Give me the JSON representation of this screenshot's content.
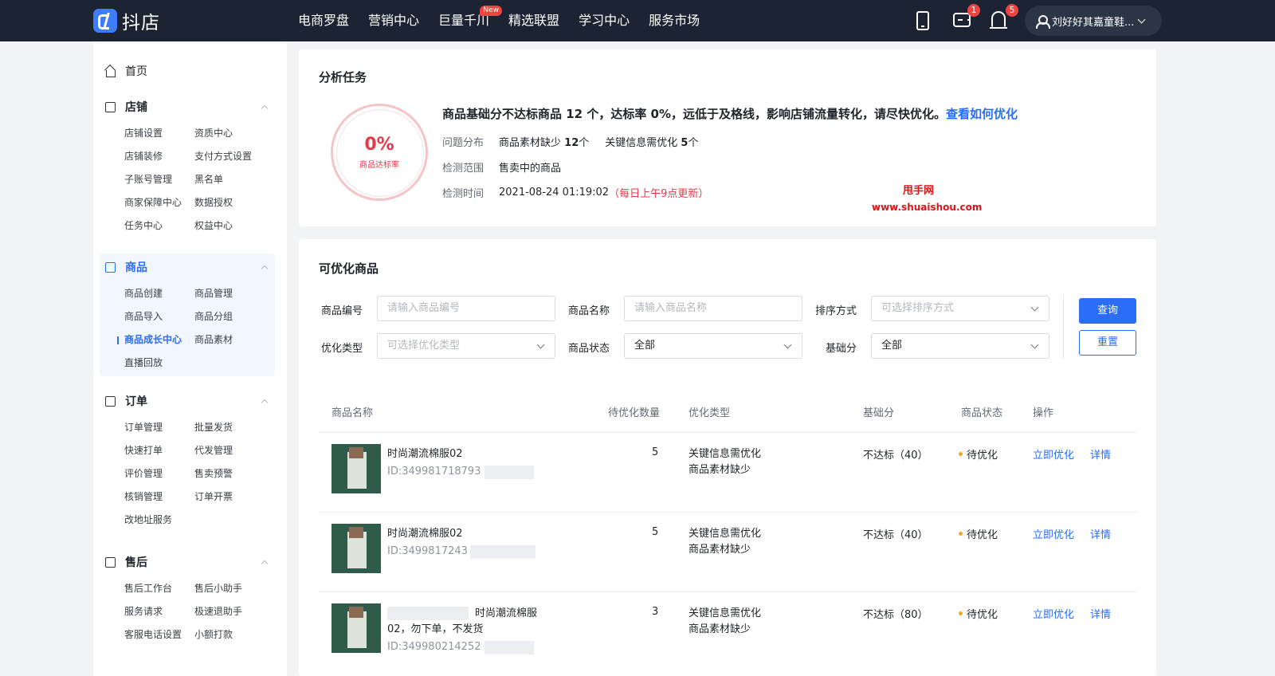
{
  "brand": {
    "name": "抖店",
    "accent": "#2b6df6",
    "topbar_bg": "#1c2433"
  },
  "nav": [
    {
      "label": "电商罗盘"
    },
    {
      "label": "营销中心"
    },
    {
      "label": "巨量千川",
      "badge": "New"
    },
    {
      "label": "精选联盟"
    },
    {
      "label": "学习中心"
    },
    {
      "label": "服务市场"
    }
  ],
  "header_icons": {
    "phone": "phone-icon",
    "message": "message-icon",
    "message_count": "1",
    "bell": "bell-icon",
    "bell_count": "5"
  },
  "user": {
    "name": "刘好好其嘉童鞋..."
  },
  "sidebar": {
    "home": "首页",
    "groups": [
      {
        "title": "店铺",
        "items": [
          "店铺设置",
          "资质中心",
          "店铺装修",
          "支付方式设置",
          "子账号管理",
          "黑名单",
          "商家保障中心",
          "数据授权",
          "任务中心",
          "权益中心"
        ]
      },
      {
        "title": "商品",
        "items": [
          "商品创建",
          "商品管理",
          "商品导入",
          "商品分组",
          "商品成长中心",
          "商品素材",
          "直播回放"
        ]
      },
      {
        "title": "订单",
        "items": [
          "订单管理",
          "批量发货",
          "快速打单",
          "代发管理",
          "评价管理",
          "售卖预警",
          "核销管理",
          "订单开票",
          "改地址服务"
        ]
      },
      {
        "title": "售后",
        "items": [
          "售后工作台",
          "售后小助手",
          "服务请求",
          "极速退助手",
          "客服电话设置",
          "小额打款"
        ]
      }
    ]
  },
  "analysis": {
    "title": "分析任务",
    "rate_value": "0%",
    "rate_label": "商品达标率",
    "headline": "商品基础分不达标商品 12 个，达标率 0%，远低于及格线，影响店铺流量转化，请尽快优化。",
    "headline_link": "查看如何优化",
    "issue_label": "问题分布",
    "issue_1_name": "商品素材缺少",
    "issue_1_count": "12",
    "issue_1_unit": "个",
    "issue_2_name": "关键信息需优化",
    "issue_2_count": "5",
    "issue_2_unit": "个",
    "scope_label": "检测范围",
    "scope_value": "售卖中的商品",
    "time_label": "检测时间",
    "time_value": "2021-08-24 01:19:02",
    "time_note": "（每日上午9点更新）"
  },
  "watermark": {
    "line1": "甩手网",
    "line2": "www.shuaishou.com"
  },
  "products": {
    "title": "可优化商品",
    "filters": {
      "id_label": "商品编号",
      "id_placeholder": "请输入商品编号",
      "name_label": "商品名称",
      "name_placeholder": "请输入商品名称",
      "sort_label": "排序方式",
      "sort_placeholder": "可选择排序方式",
      "type_label": "优化类型",
      "type_placeholder": "可选择优化类型",
      "status_label": "商品状态",
      "status_value": "全部",
      "score_label": "基础分",
      "score_value": "全部",
      "query": "查询",
      "reset": "重置"
    },
    "columns": [
      "商品名称",
      "待优化数量",
      "优化类型",
      "基础分",
      "商品状态",
      "操作"
    ],
    "rows": [
      {
        "name": "时尚潮流棉服02",
        "id": "ID:349981718793",
        "qty": "5",
        "type_1": "关键信息需优化",
        "type_2": "商品素材缺少",
        "score": "不达标（40）",
        "status": "待优化",
        "act_1": "立即优化",
        "act_2": "详情"
      },
      {
        "name": "时尚潮流棉服02",
        "id": "ID:3499817243",
        "qty": "5",
        "type_1": "关键信息需优化",
        "type_2": "商品素材缺少",
        "score": "不达标（40）",
        "status": "待优化",
        "act_1": "立即优化",
        "act_2": "详情"
      },
      {
        "name_1": "时尚潮流棉服",
        "name_2": "02，勿下单，不发货",
        "id": "ID:349980214252",
        "qty": "3",
        "type_1": "关键信息需优化",
        "type_2": "商品素材缺少",
        "score": "不达标（80）",
        "status": "待优化",
        "act_1": "立即优化",
        "act_2": "详情"
      }
    ]
  }
}
